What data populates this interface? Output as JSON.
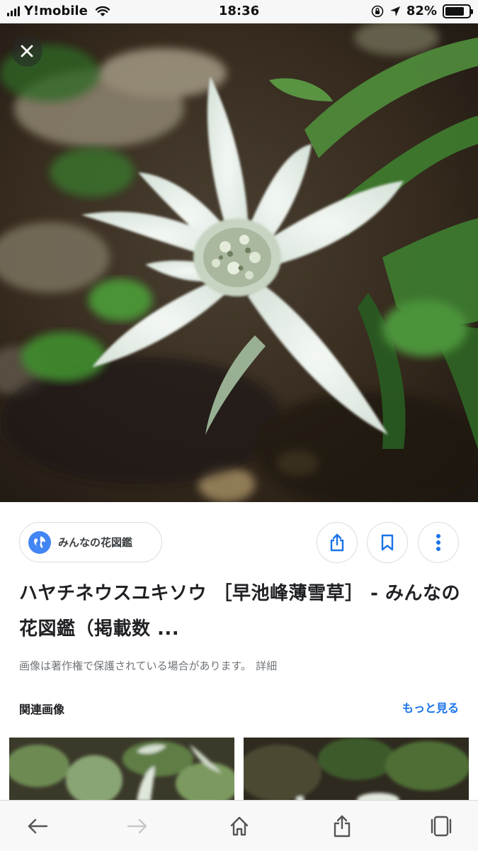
{
  "status_bar": {
    "carrier": "Y!mobile",
    "time": "18:36",
    "battery_percent": "82%",
    "battery_level": 0.82,
    "icons": [
      "signal-icon",
      "wifi-icon",
      "orientation-lock-icon",
      "location-icon",
      "battery-icon"
    ]
  },
  "viewer": {
    "close_icon": "close-icon",
    "image_subject": "white edelweiss flower"
  },
  "source": {
    "name": "みんなの花図鑑",
    "icon": "globe-icon"
  },
  "actions": {
    "share_icon": "share-icon",
    "bookmark_icon": "bookmark-icon",
    "more_icon": "more-vertical-icon"
  },
  "result": {
    "title": "ハヤチネウスユキソウ ［早池峰薄雪草］ - みんなの花図鑑（掲載数 ...",
    "copyright_notice": "画像は著作権で保護されている場合があります。",
    "details_link": "詳細"
  },
  "related": {
    "label": "関連画像",
    "more_link": "もっと見る"
  },
  "toolbar": {
    "back_icon": "back-arrow-icon",
    "forward_icon": "forward-arrow-icon",
    "home_icon": "home-icon",
    "share_icon": "share-icon",
    "tabs_icon": "tabs-icon"
  },
  "colors": {
    "accent_blue": "#1a73e8",
    "globe_blue": "#4285f4",
    "text_primary": "#202124",
    "text_secondary": "#70757a"
  }
}
